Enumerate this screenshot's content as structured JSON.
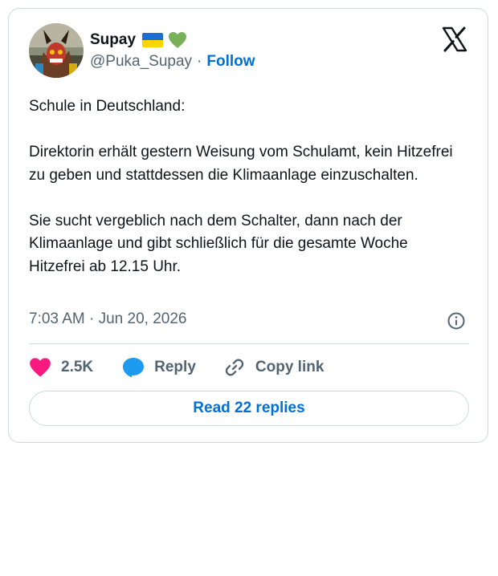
{
  "author": {
    "display_name": "Supay",
    "flag_emoji": "ukraine-flag",
    "heart_emoji": "green-heart",
    "handle": "@Puka_Supay",
    "separator": "·",
    "follow_label": "Follow"
  },
  "platform_logo": "x-logo",
  "tweet": {
    "paragraphs": [
      "Schule in Deutschland:",
      "Direktorin erhält gestern Weisung vom Schulamt, kein Hitzefrei zu geben und stattdessen die Klimaanlage einzuschalten.",
      "Sie sucht vergeblich nach dem Schalter, dann nach der Klimaanlage und gibt schließlich für die gesamte Woche Hitzefrei ab 12.15 Uhr."
    ],
    "timestamp": "7:03 AM · Jun 20, 2026"
  },
  "actions": {
    "like_count": "2.5K",
    "reply_label": "Reply",
    "copy_link_label": "Copy link"
  },
  "read_replies_label": "Read 22 replies",
  "colors": {
    "accent": "#006fd6",
    "muted": "#536471",
    "heart": "#f91880",
    "reply_bubble": "#1d9bf0",
    "border": "#cfd9de"
  }
}
